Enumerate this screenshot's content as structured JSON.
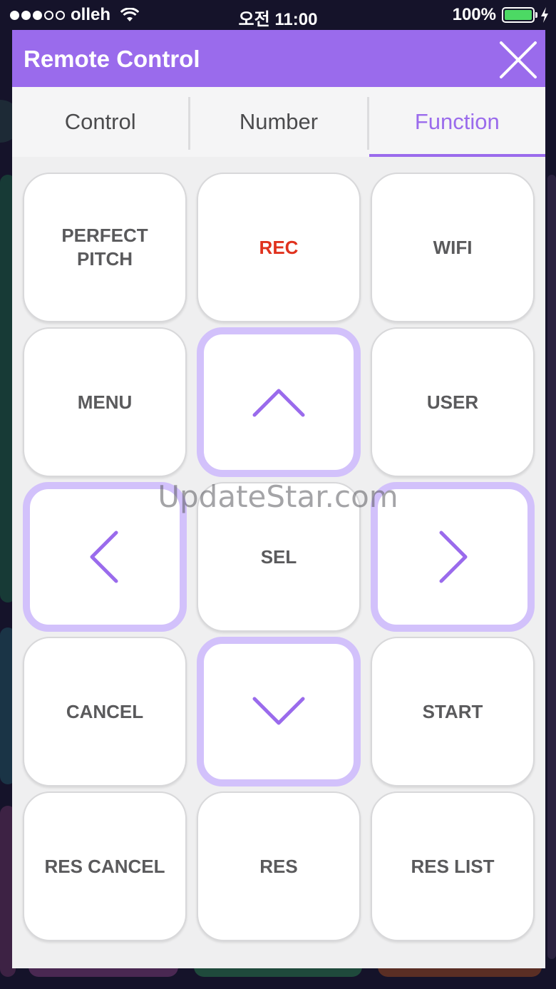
{
  "status_bar": {
    "carrier": "olleh",
    "time": "오전 11:00",
    "battery": "100%"
  },
  "header": {
    "title": "Remote Control"
  },
  "tabs": [
    {
      "label": "Control",
      "active": false
    },
    {
      "label": "Number",
      "active": false
    },
    {
      "label": "Function",
      "active": true
    }
  ],
  "keys": {
    "perfect_pitch": "PERFECT\nPITCH",
    "rec": "REC",
    "wifi": "WIFI",
    "menu": "MENU",
    "user": "USER",
    "sel": "SEL",
    "cancel": "CANCEL",
    "start": "START",
    "res_cancel": "RES CANCEL",
    "res": "RES",
    "res_list": "RES LIST"
  },
  "icons": {
    "up": "chevron-up-icon",
    "down": "chevron-down-icon",
    "left": "chevron-left-icon",
    "right": "chevron-right-icon",
    "close": "close-icon"
  },
  "watermark": "UpdateStar.com",
  "colors": {
    "accent": "#9a6bec",
    "arrow_border": "#d2c1fb",
    "rec": "#e0321e",
    "battery": "#4cd964"
  }
}
